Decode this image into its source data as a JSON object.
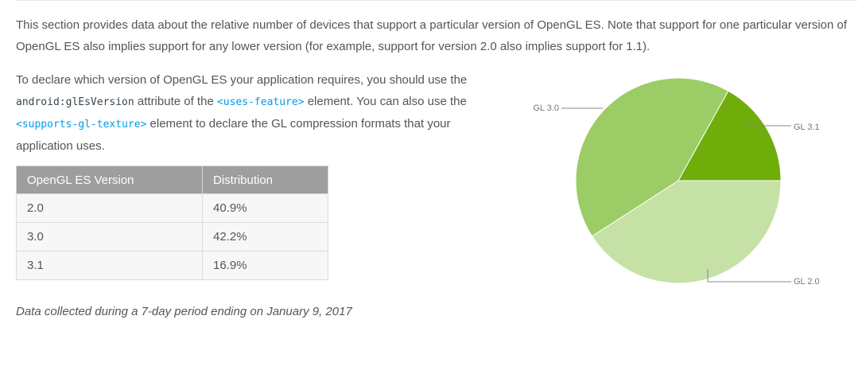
{
  "intro": {
    "line1": "This section provides data about the relative number of devices that support a particular version of OpenGL ES. Note that support for one particular version of OpenGL ES also implies support for any lower version (for example, support for version 2.0 also implies support for 1.1)."
  },
  "declare": {
    "text1": "To declare which version of OpenGL ES your application requires, you should use the ",
    "code1": "android:glEsVersion",
    "text2": " attribute of the ",
    "code2": "<uses-feature>",
    "text3": " element. You can also use the ",
    "code3": "<supports-gl-texture>",
    "text4": " element to declare the GL compression formats that your application uses."
  },
  "table": {
    "headers": [
      "OpenGL ES Version",
      "Distribution"
    ],
    "rows": [
      [
        "2.0",
        "40.9%"
      ],
      [
        "3.0",
        "42.2%"
      ],
      [
        "3.1",
        "16.9%"
      ]
    ]
  },
  "note": "Data collected during a 7-day period ending on January 9, 2017",
  "chart_data": {
    "type": "pie",
    "categories": [
      "GL 2.0",
      "GL 3.0",
      "GL 3.1"
    ],
    "values": [
      40.9,
      42.2,
      16.9
    ],
    "colors": [
      "#c5e1a5",
      "#9ccc65",
      "#6fad0b"
    ],
    "labels_shown": [
      "GL 3.0",
      "GL 3.1",
      "GL 2.0"
    ]
  }
}
